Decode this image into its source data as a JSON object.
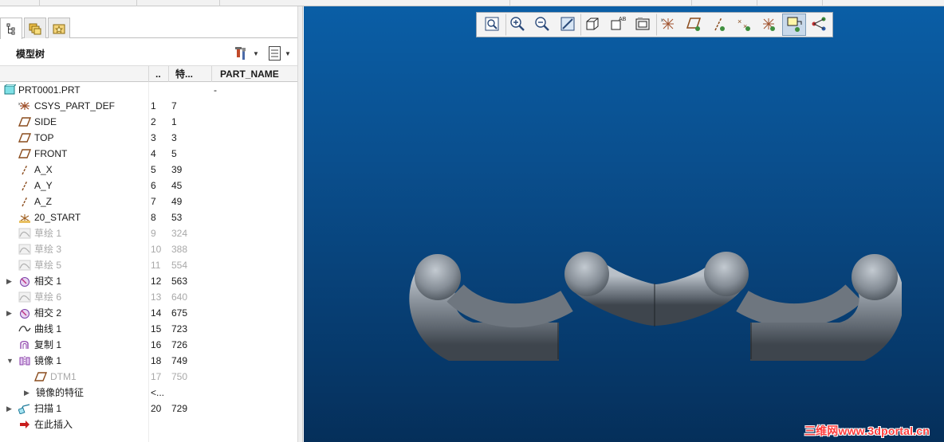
{
  "panel": {
    "tabs": [
      {
        "icon": "model-tree-icon"
      },
      {
        "icon": "folder-browser-icon"
      },
      {
        "icon": "favorites-icon"
      }
    ],
    "title": "模型树",
    "settings_icon": "tree-settings-icon",
    "columns_icon": "tree-columns-icon"
  },
  "columns": {
    "col1": "..",
    "col2": "特...",
    "col3": "PART_NAME"
  },
  "tree": [
    {
      "label": "PRT0001.PRT",
      "n1": "",
      "n2": "",
      "pn": "-",
      "indent": 0,
      "icon": "part-icon",
      "dim": false,
      "twisty": ""
    },
    {
      "label": "CSYS_PART_DEF",
      "n1": "1",
      "n2": "7",
      "pn": "",
      "indent": 1,
      "icon": "csys-icon",
      "dim": false,
      "twisty": ""
    },
    {
      "label": "SIDE",
      "n1": "2",
      "n2": "1",
      "pn": "",
      "indent": 1,
      "icon": "datum-plane-icon",
      "dim": false,
      "twisty": ""
    },
    {
      "label": "TOP",
      "n1": "3",
      "n2": "3",
      "pn": "",
      "indent": 1,
      "icon": "datum-plane-icon",
      "dim": false,
      "twisty": ""
    },
    {
      "label": "FRONT",
      "n1": "4",
      "n2": "5",
      "pn": "",
      "indent": 1,
      "icon": "datum-plane-icon",
      "dim": false,
      "twisty": ""
    },
    {
      "label": "A_X",
      "n1": "5",
      "n2": "39",
      "pn": "",
      "indent": 1,
      "icon": "datum-axis-icon",
      "dim": false,
      "twisty": ""
    },
    {
      "label": "A_Y",
      "n1": "6",
      "n2": "45",
      "pn": "",
      "indent": 1,
      "icon": "datum-axis-icon",
      "dim": false,
      "twisty": ""
    },
    {
      "label": "A_Z",
      "n1": "7",
      "n2": "49",
      "pn": "",
      "indent": 1,
      "icon": "datum-axis-icon",
      "dim": false,
      "twisty": ""
    },
    {
      "label": "20_START",
      "n1": "8",
      "n2": "53",
      "pn": "",
      "indent": 1,
      "icon": "start-csys-icon",
      "dim": false,
      "twisty": ""
    },
    {
      "label": "草绘 1",
      "n1": "9",
      "n2": "324",
      "pn": "",
      "indent": 1,
      "icon": "sketch-icon",
      "dim": true,
      "twisty": ""
    },
    {
      "label": "草绘 3",
      "n1": "10",
      "n2": "388",
      "pn": "",
      "indent": 1,
      "icon": "sketch-icon",
      "dim": true,
      "twisty": ""
    },
    {
      "label": "草绘 5",
      "n1": "11",
      "n2": "554",
      "pn": "",
      "indent": 1,
      "icon": "sketch-icon",
      "dim": true,
      "twisty": ""
    },
    {
      "label": "相交 1",
      "n1": "12",
      "n2": "563",
      "pn": "",
      "indent": 1,
      "icon": "intersect-icon",
      "dim": false,
      "twisty": "▶"
    },
    {
      "label": "草绘 6",
      "n1": "13",
      "n2": "640",
      "pn": "",
      "indent": 1,
      "icon": "sketch-icon",
      "dim": true,
      "twisty": ""
    },
    {
      "label": "相交 2",
      "n1": "14",
      "n2": "675",
      "pn": "",
      "indent": 1,
      "icon": "intersect-icon",
      "dim": false,
      "twisty": "▶"
    },
    {
      "label": "曲线 1",
      "n1": "15",
      "n2": "723",
      "pn": "",
      "indent": 1,
      "icon": "curve-icon",
      "dim": false,
      "twisty": ""
    },
    {
      "label": "复制 1",
      "n1": "16",
      "n2": "726",
      "pn": "",
      "indent": 1,
      "icon": "copy-icon",
      "dim": false,
      "twisty": ""
    },
    {
      "label": "镜像 1",
      "n1": "18",
      "n2": "749",
      "pn": "",
      "indent": 1,
      "icon": "mirror-icon",
      "dim": false,
      "twisty": "▼"
    },
    {
      "label": "DTM1",
      "n1": "17",
      "n2": "750",
      "pn": "",
      "indent": 2,
      "icon": "datum-plane-icon",
      "dim": true,
      "twisty": ""
    },
    {
      "label": "镜像的特征",
      "n1": "<...",
      "n2": "",
      "pn": "",
      "indent": 2,
      "icon": "",
      "dim": false,
      "twisty": "▶"
    },
    {
      "label": "扫描 1",
      "n1": "20",
      "n2": "729",
      "pn": "",
      "indent": 1,
      "icon": "sweep-icon",
      "dim": false,
      "twisty": "▶"
    },
    {
      "label": "在此插入",
      "n1": "",
      "n2": "",
      "pn": "",
      "indent": 1,
      "icon": "insert-here-icon",
      "dim": false,
      "twisty": ""
    }
  ],
  "view_toolbar": [
    {
      "icon": "refit-icon",
      "active": false
    },
    {
      "icon": "zoom-in-icon",
      "active": false
    },
    {
      "icon": "zoom-out-icon",
      "active": false
    },
    {
      "icon": "repaint-icon",
      "active": false
    },
    {
      "icon": "display-style-icon",
      "active": false
    },
    {
      "icon": "saved-orientations-icon",
      "active": false
    },
    {
      "icon": "view-manager-icon",
      "active": false
    },
    {
      "icon": "csys-display-icon",
      "active": false
    },
    {
      "icon": "plane-display-icon",
      "active": false
    },
    {
      "icon": "axis-display-icon",
      "active": false
    },
    {
      "icon": "point-display-icon",
      "active": false
    },
    {
      "icon": "csys-toggle-icon",
      "active": false
    },
    {
      "icon": "annotation-display-icon",
      "active": true
    },
    {
      "icon": "spin-center-icon",
      "active": false
    }
  ],
  "watermark": "三维网www.3dportal.cn",
  "colors": {
    "viewport_top": "#0a5ea6",
    "viewport_bottom": "#052f5a",
    "model": "#8a929b",
    "dim_text": "#a8a8a8"
  }
}
